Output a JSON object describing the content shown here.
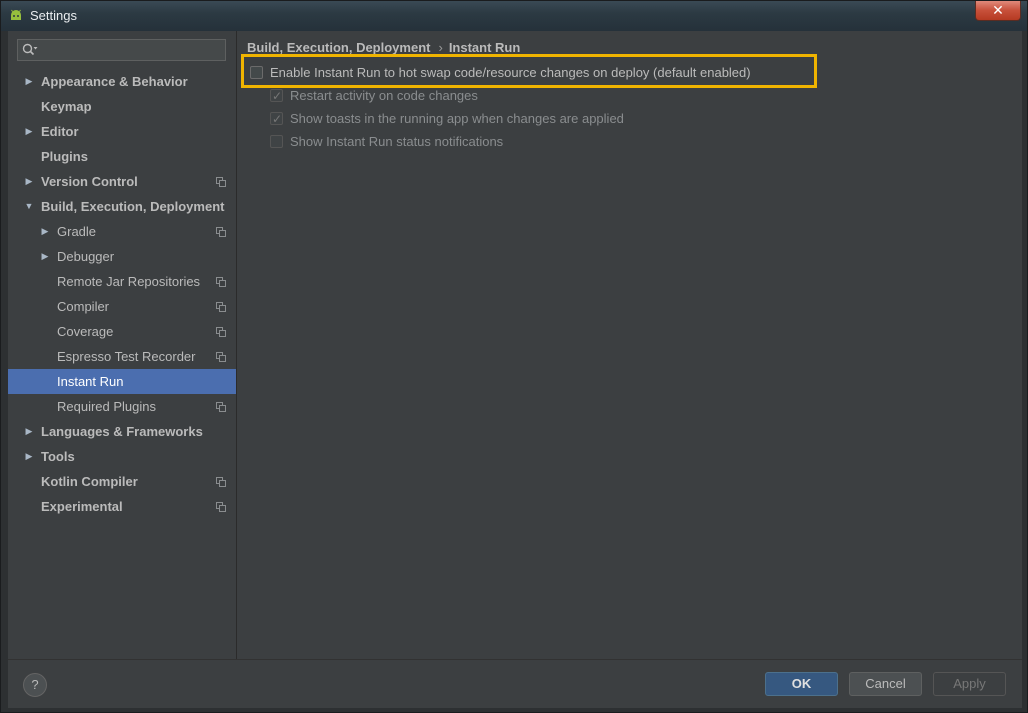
{
  "window": {
    "title": "Settings",
    "close_label": "✕"
  },
  "search": {
    "placeholder": "",
    "value": ""
  },
  "sidebar": {
    "items": [
      {
        "label": "Appearance & Behavior",
        "indent": 0,
        "arrow": "right",
        "bold": true,
        "copy": false,
        "selected": false
      },
      {
        "label": "Keymap",
        "indent": 0,
        "arrow": "",
        "bold": true,
        "copy": false,
        "selected": false
      },
      {
        "label": "Editor",
        "indent": 0,
        "arrow": "right",
        "bold": true,
        "copy": false,
        "selected": false
      },
      {
        "label": "Plugins",
        "indent": 0,
        "arrow": "",
        "bold": true,
        "copy": false,
        "selected": false
      },
      {
        "label": "Version Control",
        "indent": 0,
        "arrow": "right",
        "bold": true,
        "copy": true,
        "selected": false
      },
      {
        "label": "Build, Execution, Deployment",
        "indent": 0,
        "arrow": "down",
        "bold": true,
        "copy": false,
        "selected": false
      },
      {
        "label": "Gradle",
        "indent": 1,
        "arrow": "right",
        "bold": false,
        "copy": true,
        "selected": false
      },
      {
        "label": "Debugger",
        "indent": 1,
        "arrow": "right",
        "bold": false,
        "copy": false,
        "selected": false
      },
      {
        "label": "Remote Jar Repositories",
        "indent": 1,
        "arrow": "",
        "bold": false,
        "copy": true,
        "selected": false
      },
      {
        "label": "Compiler",
        "indent": 1,
        "arrow": "",
        "bold": false,
        "copy": true,
        "selected": false
      },
      {
        "label": "Coverage",
        "indent": 1,
        "arrow": "",
        "bold": false,
        "copy": true,
        "selected": false
      },
      {
        "label": "Espresso Test Recorder",
        "indent": 1,
        "arrow": "",
        "bold": false,
        "copy": true,
        "selected": false
      },
      {
        "label": "Instant Run",
        "indent": 1,
        "arrow": "",
        "bold": false,
        "copy": false,
        "selected": true
      },
      {
        "label": "Required Plugins",
        "indent": 1,
        "arrow": "",
        "bold": false,
        "copy": true,
        "selected": false
      },
      {
        "label": "Languages & Frameworks",
        "indent": 0,
        "arrow": "right",
        "bold": true,
        "copy": false,
        "selected": false
      },
      {
        "label": "Tools",
        "indent": 0,
        "arrow": "right",
        "bold": true,
        "copy": false,
        "selected": false
      },
      {
        "label": "Kotlin Compiler",
        "indent": 0,
        "arrow": "",
        "bold": true,
        "copy": true,
        "selected": false
      },
      {
        "label": "Experimental",
        "indent": 0,
        "arrow": "",
        "bold": true,
        "copy": true,
        "selected": false
      }
    ]
  },
  "breadcrumb": {
    "parent": "Build, Execution, Deployment",
    "separator": "›",
    "current": "Instant Run"
  },
  "options": {
    "enable": {
      "label": "Enable Instant Run to hot swap code/resource changes on deploy (default enabled)",
      "checked": false,
      "enabled": true
    },
    "restart": {
      "label": "Restart activity on code changes",
      "checked": true,
      "enabled": false
    },
    "toasts": {
      "label": "Show toasts in the running app when changes are applied",
      "checked": true,
      "enabled": false
    },
    "status": {
      "label": "Show Instant Run status notifications",
      "checked": false,
      "enabled": false
    }
  },
  "footer": {
    "help_label": "?",
    "ok_label": "OK",
    "cancel_label": "Cancel",
    "apply_label": "Apply"
  },
  "colors": {
    "highlight": "#f0b400",
    "selection": "#4b6eaf",
    "background": "#3c3f41"
  }
}
